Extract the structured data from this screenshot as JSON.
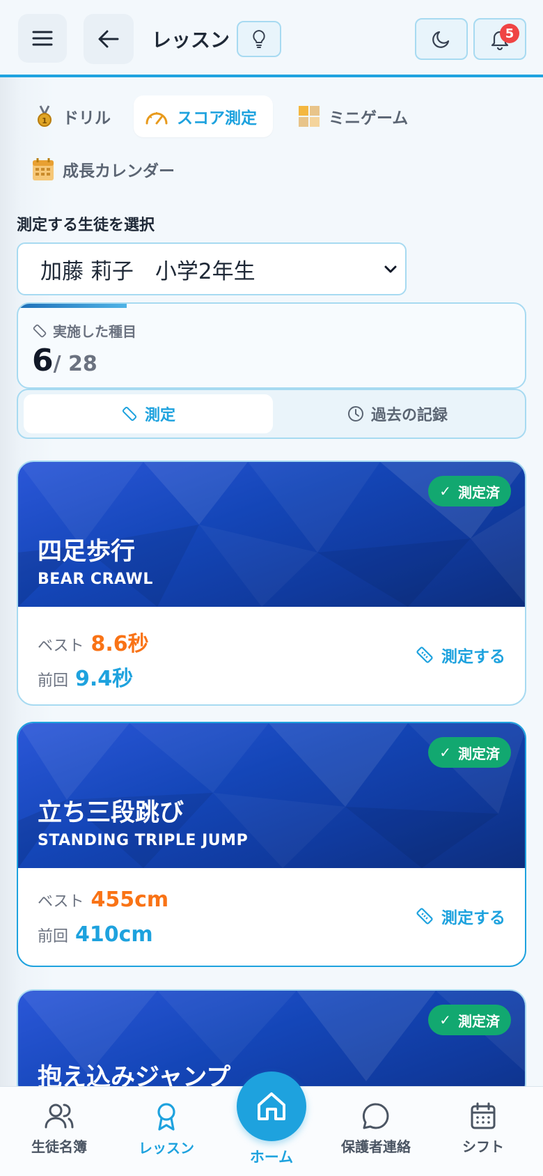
{
  "header": {
    "title": "レッスン",
    "notification_count": "5"
  },
  "tabs": [
    {
      "label": "ドリル",
      "icon": "medal-icon"
    },
    {
      "label": "スコア測定",
      "icon": "speedometer-icon"
    },
    {
      "label": "ミニゲーム",
      "icon": "grid-icon"
    },
    {
      "label": "成長カレンダー",
      "icon": "calendar-icon"
    }
  ],
  "student_select": {
    "label": "測定する生徒を選択",
    "value": "加藤 莉子　小学2年生"
  },
  "progress": {
    "label": "実施した種目",
    "done": "6",
    "total": "/ 28",
    "fraction": 0.214
  },
  "segment": {
    "measure": "測定",
    "history": "過去の記録"
  },
  "exercises": [
    {
      "ja": "四足歩行",
      "en": "BEAR CRAWL",
      "status": "測定済",
      "best_label": "ベスト",
      "best": "8.6秒",
      "prev_label": "前回",
      "prev": "9.4秒",
      "action": "測定する"
    },
    {
      "ja": "立ち三段跳び",
      "en": "STANDING TRIPLE JUMP",
      "status": "測定済",
      "best_label": "ベスト",
      "best": "455cm",
      "prev_label": "前回",
      "prev": "410cm",
      "action": "測定する"
    },
    {
      "ja": "抱え込みジャンプ",
      "status": "測定済"
    }
  ],
  "bottom_nav": {
    "students": "生徒名簿",
    "lesson": "レッスン",
    "home": "ホーム",
    "parents": "保護者連絡",
    "shift": "シフト"
  },
  "colors": {
    "accent": "#1ea2de",
    "best": "#f97316",
    "done_badge": "#12a870",
    "notification": "#ef4444"
  }
}
